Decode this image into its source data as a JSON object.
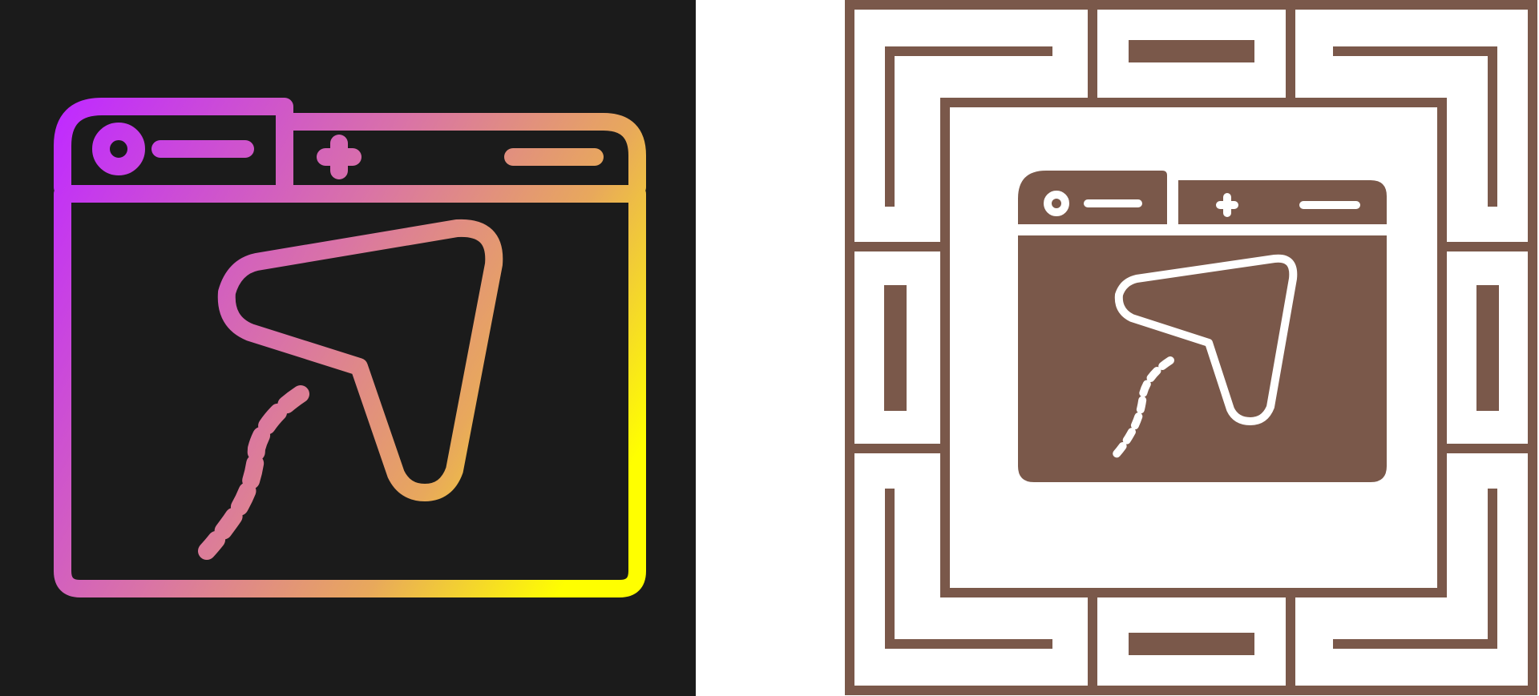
{
  "icons": [
    {
      "id": "browser-cursor-icon-gradient",
      "style": "line-gradient",
      "icon": "browser-window-cursor-icon",
      "background": "#1b1b1b",
      "gradient": [
        "#c02bff",
        "#d972a8",
        "#e8a85c",
        "#ffff00"
      ]
    },
    {
      "id": "browser-cursor-icon-glyph",
      "style": "glyph-with-frame",
      "icon": "browser-window-cursor-icon",
      "background": "#ffffff",
      "color": "#7a584a"
    }
  ]
}
